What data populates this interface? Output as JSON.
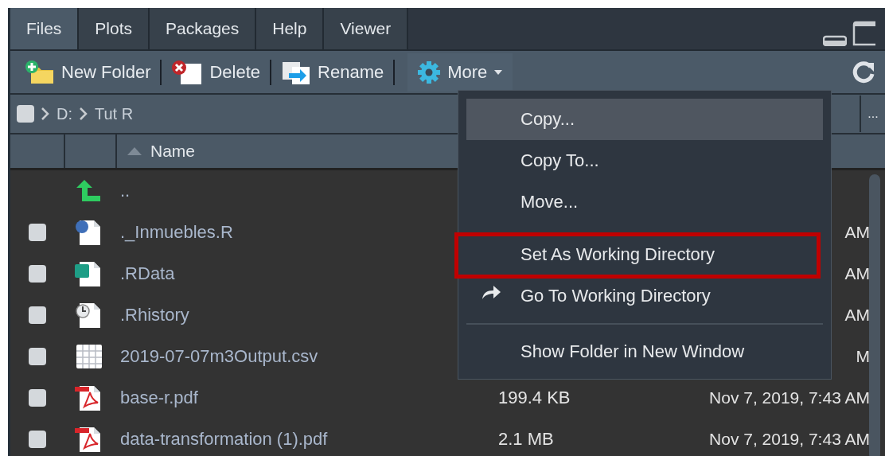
{
  "tabs": [
    {
      "label": "Files",
      "selected": true
    },
    {
      "label": "Plots",
      "selected": false
    },
    {
      "label": "Packages",
      "selected": false
    },
    {
      "label": "Help",
      "selected": false
    },
    {
      "label": "Viewer",
      "selected": false
    }
  ],
  "toolbar": {
    "buttons": [
      {
        "kind": "new_folder",
        "label": "New Folder"
      },
      {
        "kind": "delete",
        "label": "Delete"
      },
      {
        "kind": "rename",
        "label": "Rename"
      }
    ],
    "more": {
      "label": "More"
    }
  },
  "breadcrumb": {
    "checked": false,
    "parts": [
      "D:",
      "Tut R"
    ],
    "more": "..."
  },
  "table": {
    "columns": [
      {
        "label": "Name"
      }
    ],
    "rows": [
      {
        "kind": "parent",
        "name": ".."
      },
      {
        "kind": "r_script",
        "name": "._Inmuebles.R",
        "modified": "AM",
        "checked": false
      },
      {
        "kind": "rdata",
        "name": ".RData",
        "modified": "AM",
        "checked": false
      },
      {
        "kind": "rhistory",
        "name": ".Rhistory",
        "modified": "AM",
        "checked": false
      },
      {
        "kind": "csv",
        "name": "2019-07-07m3Output.csv",
        "modified": "M",
        "checked": false
      },
      {
        "kind": "pdf",
        "name": "base-r.pdf",
        "size": "199.4 KB",
        "modified": "Nov 7, 2019, 7:43 AM",
        "checked": false
      },
      {
        "kind": "pdf",
        "name": "data-transformation (1).pdf",
        "size": "2.1 MB",
        "modified": "Nov 7, 2019, 7:43 AM",
        "checked": false
      }
    ]
  },
  "menu": {
    "items": [
      {
        "kind": "item",
        "label": "Copy...",
        "selected": true,
        "annotated": false
      },
      {
        "kind": "item",
        "label": "Copy To...",
        "selected": false,
        "annotated": false
      },
      {
        "kind": "item",
        "label": "Move...",
        "selected": false,
        "annotated": false
      },
      {
        "kind": "item",
        "label": "Set As Working Directory",
        "selected": false,
        "annotated": true
      },
      {
        "kind": "icon_item",
        "label": "Go To Working Directory",
        "selected": false,
        "annotated": false
      },
      {
        "kind": "separator"
      },
      {
        "kind": "item",
        "label": "Show Folder in New Window",
        "selected": false,
        "annotated": false
      }
    ]
  }
}
